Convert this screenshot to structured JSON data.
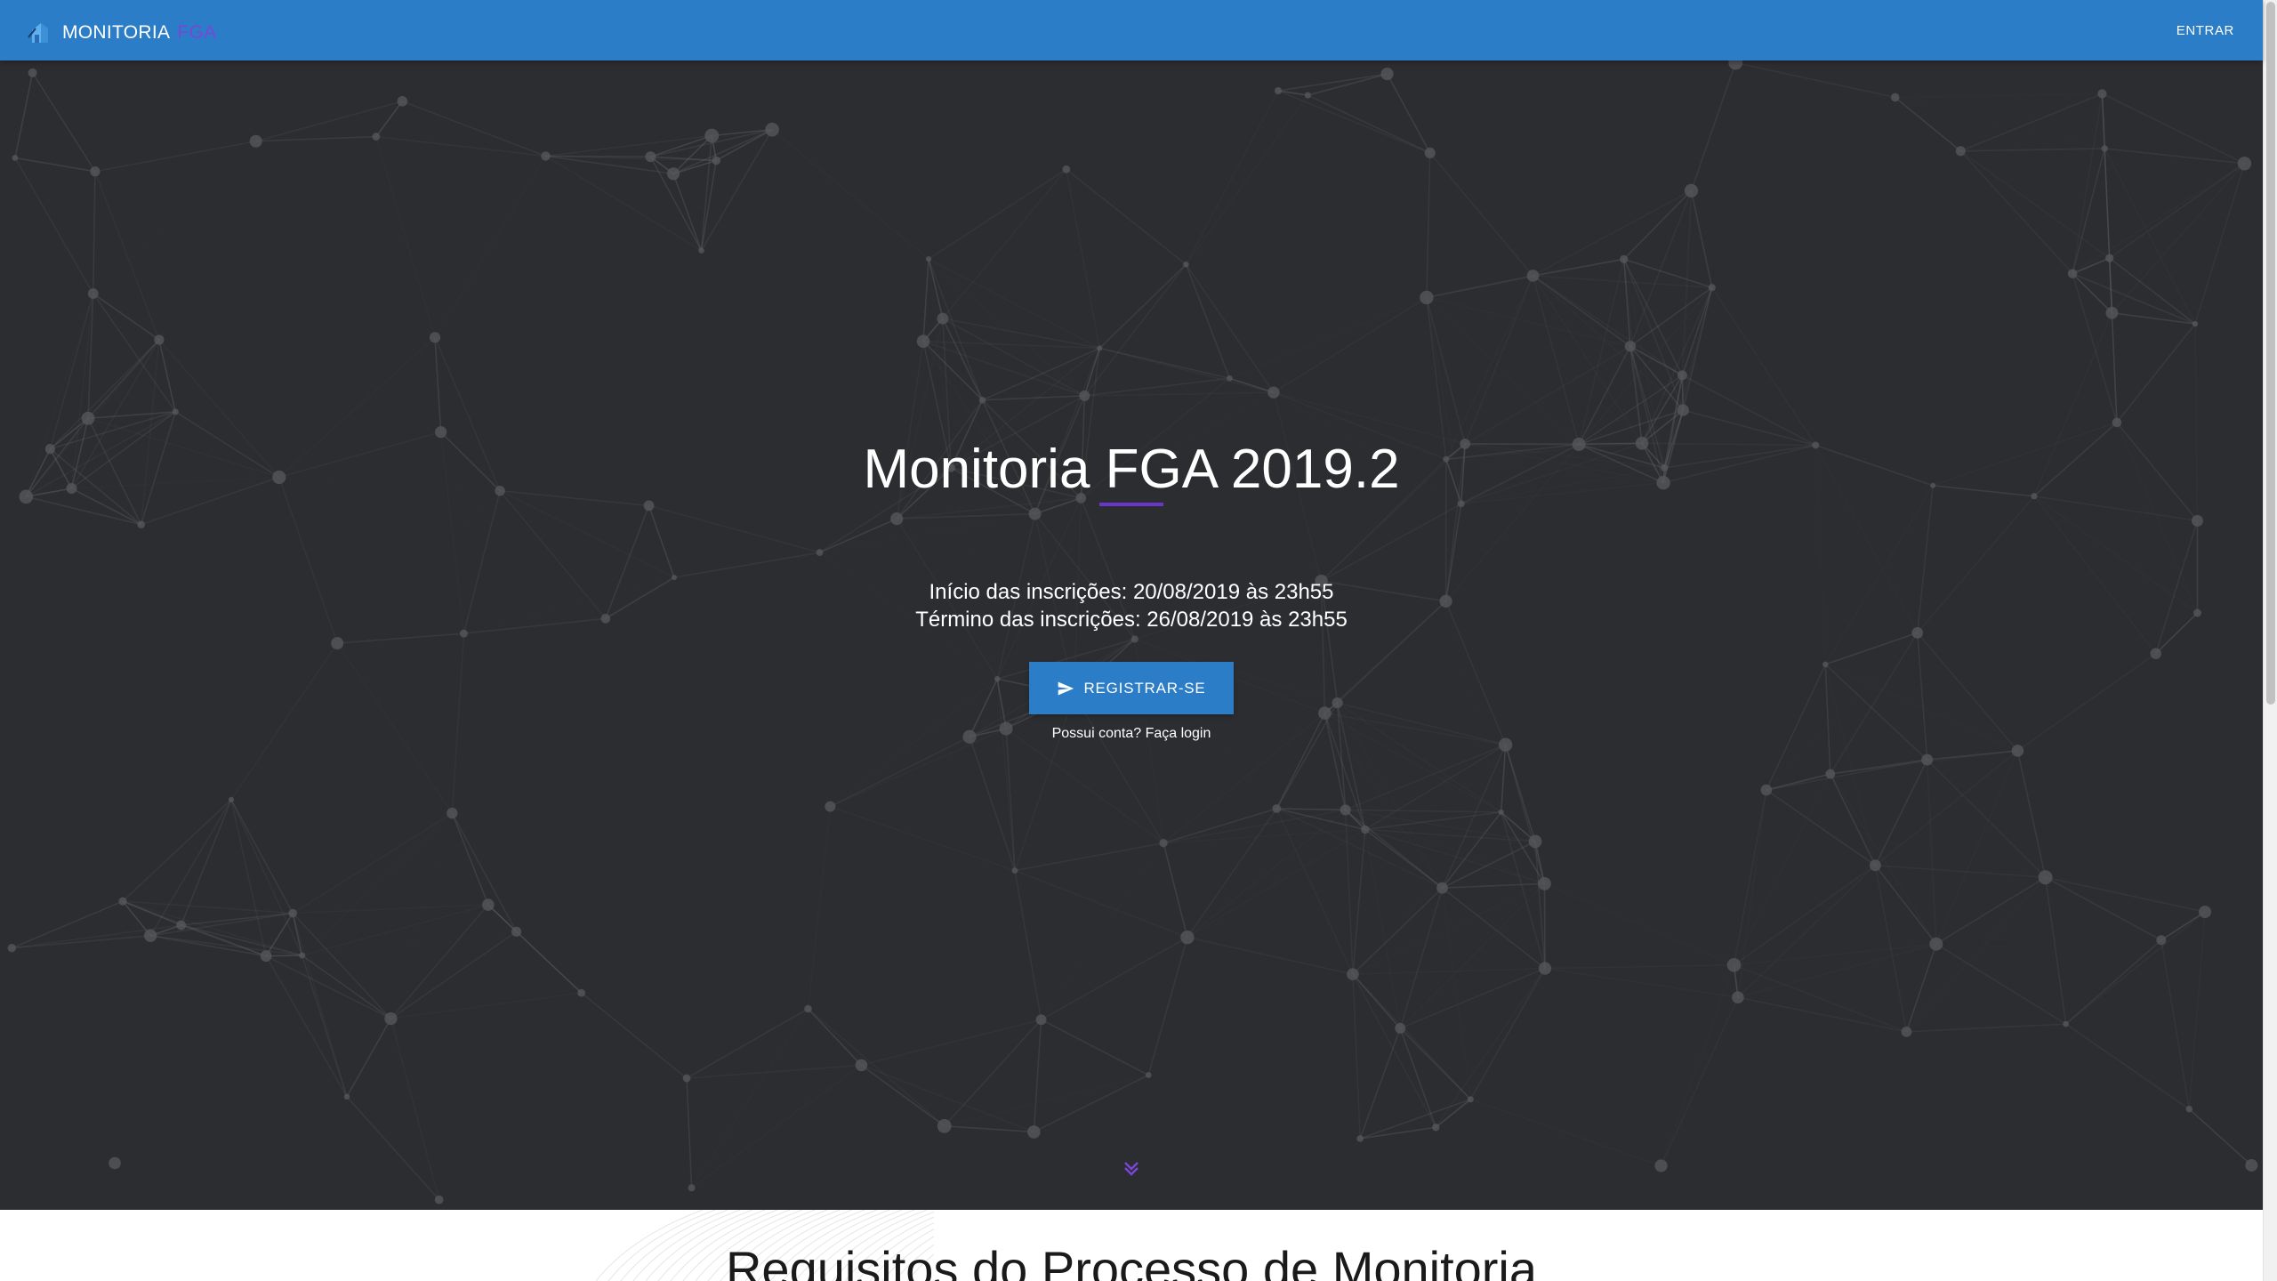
{
  "navbar": {
    "brand": "MONITORIA",
    "brand_accent": "FGA",
    "login": "ENTRAR",
    "brand_icon": "building-icon"
  },
  "hero": {
    "title": "Monitoria FGA 2019.2",
    "start_date": "Início das inscrições: 20/08/2019 às 23h55",
    "end_date": "Término das inscrições: 26/08/2019 às 23h55",
    "register_button": "REGISTRAR-SE",
    "register_icon": "send-icon",
    "login_link": "Possui conta? Faça login",
    "scroll_icon": "double-chevron-down-icon"
  },
  "requirements": {
    "title": "Requisitos do Processo de Monitoria"
  },
  "colors": {
    "primary": "#2a7dc6",
    "accent": "#6a36c9",
    "hero_background": "#2c2d30"
  }
}
